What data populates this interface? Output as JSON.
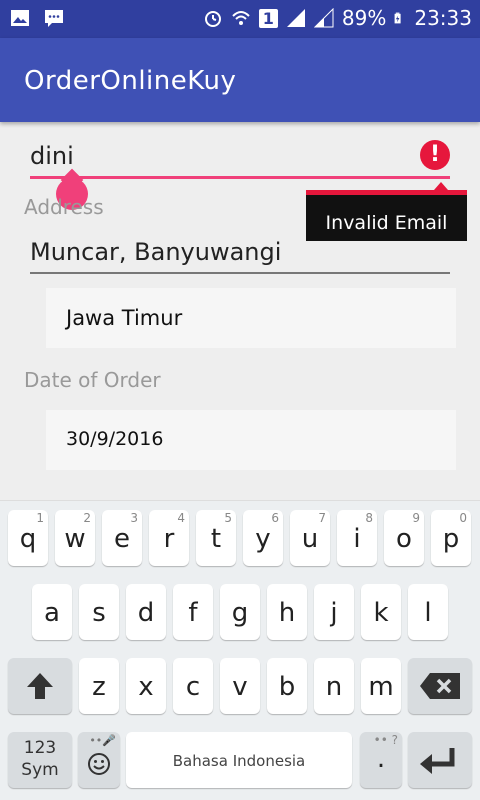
{
  "status_bar": {
    "battery": "89%",
    "time": "23:33",
    "sim": "1"
  },
  "app_bar": {
    "title": "OrderOnlineKuy"
  },
  "form": {
    "email_value": "dini",
    "email_error": "Invalid Email",
    "address_label": "Address",
    "address_value": "Muncar, Banyuwangi",
    "province_value": "Jawa Timur",
    "date_label": "Date of Order",
    "date_value": "30/9/2016"
  },
  "keyboard": {
    "row1": [
      {
        "k": "q",
        "h": "1"
      },
      {
        "k": "w",
        "h": "2"
      },
      {
        "k": "e",
        "h": "3"
      },
      {
        "k": "r",
        "h": "4"
      },
      {
        "k": "t",
        "h": "5"
      },
      {
        "k": "y",
        "h": "6"
      },
      {
        "k": "u",
        "h": "7"
      },
      {
        "k": "i",
        "h": "8"
      },
      {
        "k": "o",
        "h": "9"
      },
      {
        "k": "p",
        "h": "0"
      }
    ],
    "row2": [
      "a",
      "s",
      "d",
      "f",
      "g",
      "h",
      "j",
      "k",
      "l"
    ],
    "row3": [
      "z",
      "x",
      "c",
      "v",
      "b",
      "n",
      "m"
    ],
    "sym_label_1": "123",
    "sym_label_2": "Sym",
    "space_label": "Bahasa Indonesia",
    "period": ".",
    "period_hint": "•• ?"
  }
}
